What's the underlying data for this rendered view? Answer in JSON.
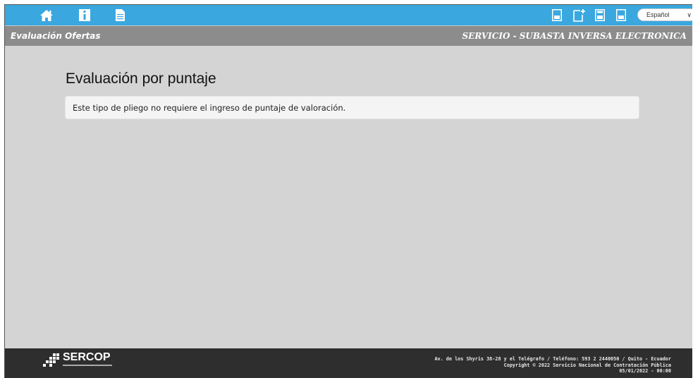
{
  "toolbar": {
    "left_icons": [
      "home-icon",
      "info-icon",
      "document-icon"
    ],
    "right_icons": [
      "pdf-icon",
      "new-document-icon",
      "save-icon",
      "pdf-icon"
    ],
    "language": {
      "selected": "Español"
    }
  },
  "header": {
    "section": "Evaluación Ofertas",
    "service": "SERVICIO - SUBASTA INVERSA ELECTRONICA"
  },
  "main": {
    "title": "Evaluación por puntaje",
    "message": "Este tipo de pliego no requiere el ingreso de puntaje de valoración."
  },
  "footer": {
    "logo_text": "SERCOP",
    "address": "Av. de los Shyris 38-28 y el Telégrafo / Teléfono: 593 2 2440050 / Quito - Ecuador",
    "copyright": "Copyright © 2022 Servicio Nacional de Contratación Pública",
    "date": "05/01/2022 - 00:00"
  },
  "colors": {
    "toolbar_bg": "#3aa8df",
    "subheader_bg": "#8c8c8c",
    "content_bg": "#d4d4d4",
    "footer_bg": "#2e2e2e"
  }
}
